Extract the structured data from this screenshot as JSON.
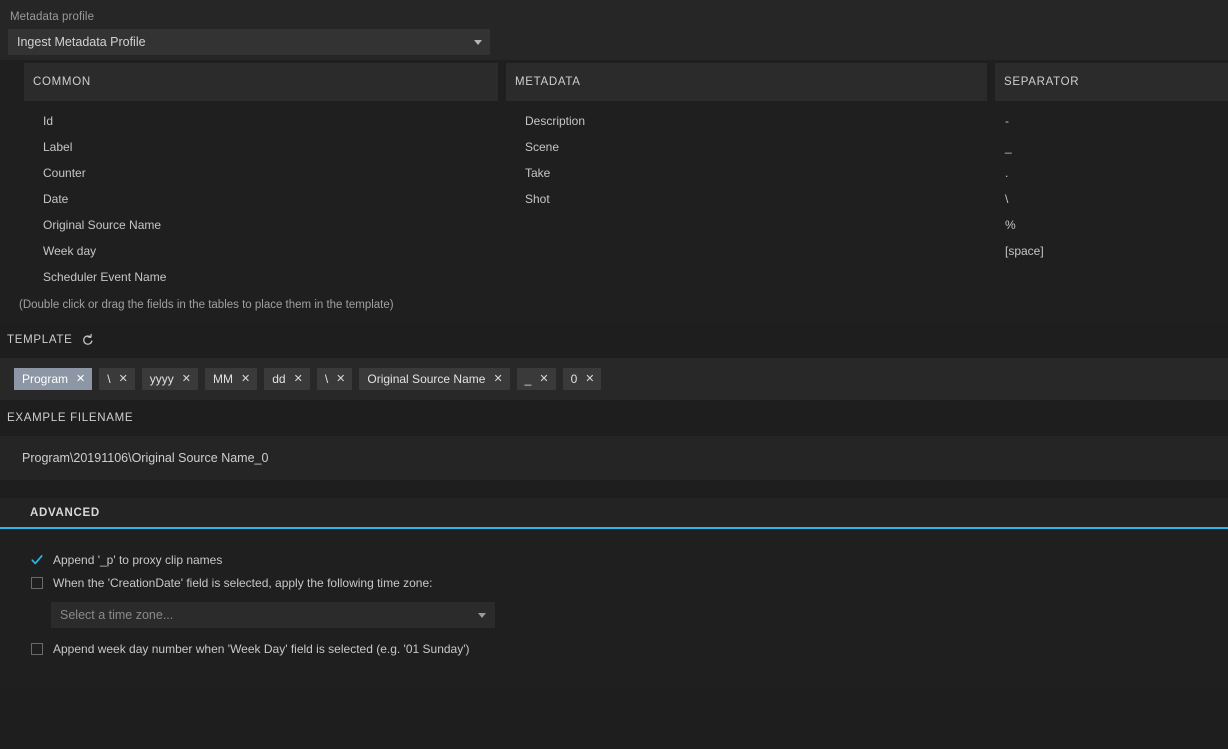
{
  "profile": {
    "label": "Metadata profile",
    "value": "Ingest Metadata Profile"
  },
  "columns": {
    "common": {
      "header": "COMMON",
      "fields": [
        "Id",
        "Label",
        "Counter",
        "Date",
        "Original Source Name",
        "Week day",
        "Scheduler Event Name"
      ]
    },
    "metadata": {
      "header": "METADATA",
      "fields": [
        "Description",
        "Scene",
        "Take",
        "Shot"
      ]
    },
    "separator": {
      "header": "SEPARATOR",
      "fields": [
        "-",
        "_",
        ".",
        "\\",
        "%",
        "[space]"
      ]
    }
  },
  "hint": "(Double click or drag the fields in the tables to place them in the template)",
  "template": {
    "title": "TEMPLATE",
    "reset_icon": "reset-arrow-icon",
    "close_glyph": "✕",
    "chips": [
      {
        "label": "Program",
        "selected": true
      },
      {
        "label": "\\",
        "selected": false
      },
      {
        "label": "yyyy",
        "selected": false
      },
      {
        "label": "MM",
        "selected": false
      },
      {
        "label": "dd",
        "selected": false
      },
      {
        "label": "\\",
        "selected": false
      },
      {
        "label": "Original Source Name",
        "selected": false
      },
      {
        "label": "_",
        "selected": false
      },
      {
        "label": "0",
        "selected": false
      }
    ]
  },
  "example": {
    "title": "EXAMPLE FILENAME",
    "value": "Program\\20191106\\Original Source Name_0"
  },
  "advanced": {
    "title": "ADVANCED",
    "accent_color": "#29b6e8",
    "options": [
      {
        "label": "Append '_p' to proxy clip names",
        "checked": true
      },
      {
        "label": "When the 'CreationDate' field is selected, apply the following time zone:",
        "checked": false
      },
      {
        "label": "Append week day number when 'Week Day' field is selected (e.g. '01 Sunday')",
        "checked": false
      }
    ],
    "timezone": {
      "placeholder": "Select a time zone..."
    }
  }
}
